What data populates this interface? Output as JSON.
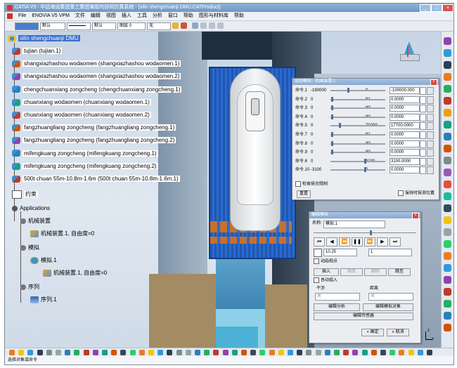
{
  "window": {
    "title": "CATIA V5 - 中远海运集团重工集团某船坞协同仿真系统 - [silin shengchuanji DMU.CATProduct]",
    "btn_min": "_",
    "btn_max": "□",
    "btn_close": "×"
  },
  "menu": [
    "File",
    "ENOVIA V5 VPM",
    "文件",
    "编辑",
    "视图",
    "插入",
    "工具",
    "分析",
    "窗口",
    "帮助",
    "图形与材料库",
    "帮助"
  ],
  "toolbar": {
    "combo_style": "默认",
    "combo_line": "默认",
    "combo_layer": "图层 0",
    "combo_filter": "无"
  },
  "tree": {
    "root": "silin shengchuanji DMU",
    "items": [
      "tujian (tujian.1)",
      "shangxiazhashou wodaomen (shangxiazhashou wodaomen.1)",
      "shangxiazhashou wodaomen (shangxiazhashou wodaomen.2)",
      "chengchuanxiang zongcheng (chengchuanxiang zongcheng.1)",
      "chuanxiang wodaomen (chuanxiang wodaomen.1)",
      "chuanxiang wodaomen (chuanxiang wodaomen.2)",
      "fangzhuangliang zongcheng (fangzhuangliang zongcheng.1)",
      "fangzhuangliang zongcheng (fangzhuangliang zongcheng.2)",
      "mifengkuang zongcheng (mifengkuang zongcheng.1)",
      "mifengkuang zongcheng (mifengkuang zongcheng.2)",
      "500t chuan 55m-10.8m-1.6m (500t chuan 55m-10.8m-1.6m.1)"
    ],
    "constraints": "约束",
    "applications": "Applications",
    "mechanisms": "机械装置",
    "mechanism1": "机械装置.1, 自由度=0",
    "simulation": "模拟",
    "sim1": "模拟.1",
    "sim_mech": "机械装置.1, 自由度=0",
    "sequence": "序列",
    "sequence1": "序列.1"
  },
  "joint_dialog": {
    "title": "运动模拟 - 机械装置.1",
    "rows": [
      {
        "name": "命令.1",
        "min": "-190000",
        "max": "0",
        "value": "-100000.000",
        "pos": 0.5
      },
      {
        "name": "命令.2",
        "min": "0",
        "max": "91",
        "value": "0.0000",
        "pos": 0.02
      },
      {
        "name": "命令.3",
        "min": "0",
        "max": "90",
        "value": "0.0000",
        "pos": 0.02
      },
      {
        "name": "命令.4",
        "min": "0",
        "max": "90",
        "value": "0.0000",
        "pos": 0.02
      },
      {
        "name": "命令.5",
        "min": "0",
        "max": "70200",
        "value": "17700.0000",
        "pos": 0.25
      },
      {
        "name": "命令.7",
        "min": "0",
        "max": "91",
        "value": "0.0000",
        "pos": 0.02
      },
      {
        "name": "命令.8",
        "min": "0",
        "max": "90",
        "value": "0.0000",
        "pos": 0.02
      },
      {
        "name": "命令.9",
        "min": "0",
        "max": "90",
        "value": "0.0000",
        "pos": 0.02
      },
      {
        "name": "命令.6",
        "min": "0",
        "max": "3100",
        "value": "3100.0000",
        "pos": 1.0
      },
      {
        "name": "命令.10",
        "min": "-3100",
        "max": "0",
        "value": "0.0000",
        "pos": 1.0
      }
    ],
    "check_interference": "检查接合限制",
    "reset": "重置",
    "keep_position": "保持时探测位置"
  },
  "edit_dialog": {
    "title": "编辑模拟",
    "name_label": "名称:",
    "name_value": "模拟.1",
    "play_value": "10.25",
    "step_value": "1",
    "animate_viewpoint": "动画视点",
    "insert": "插入",
    "modify": "修改",
    "delete": "删除",
    "jump": "跳至",
    "auto_insert": "自动插入",
    "interference_label": "干涉",
    "distance_label": "距离",
    "interference_value": "关",
    "distance_value": "关",
    "edit_analysis": "编辑分析",
    "edit_sim_objects": "编辑模拟对象",
    "edit_sensors": "编辑传感器",
    "ok": "确定",
    "cancel": "取消"
  },
  "status": "选择对象或命令"
}
